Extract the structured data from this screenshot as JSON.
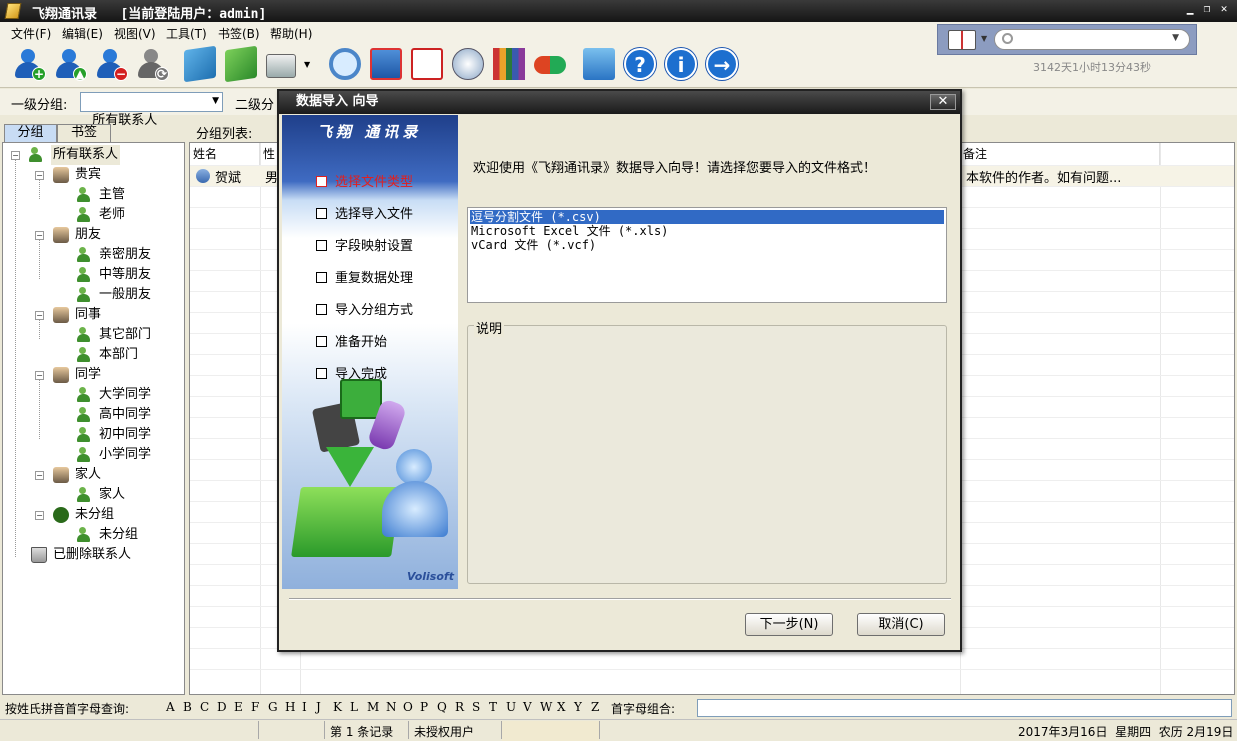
{
  "window": {
    "title": "飞翔通讯录   [当前登陆用户：admin]"
  },
  "menu": [
    "文件(F)",
    "编辑(E)",
    "视图(V)",
    "工具(T)",
    "书签(B)",
    "帮助(H)"
  ],
  "search": {
    "text": "3142天1小时13分43秒"
  },
  "toolbar": {
    "icons": [
      "add-contact-icon",
      "upload-contact-icon",
      "delete-contact-icon",
      "contact-settings-icon",
      "import-icon",
      "export-icon",
      "print-icon",
      "find-icon",
      "card-icon",
      "calendar-icon",
      "clock-icon",
      "books-icon",
      "hide-icon",
      "backup-icon",
      "help-icon",
      "info-icon",
      "next-icon"
    ]
  },
  "groupbar": {
    "level1_label": "一级分组:",
    "level1_value": "所有联系人",
    "level2_label": "二级分"
  },
  "tabs": [
    "分组",
    "书签"
  ],
  "list_label": "分组列表:",
  "tree": {
    "root": "所有联系人",
    "groups": [
      {
        "name": "贵宾",
        "children": [
          "主管",
          "老师"
        ]
      },
      {
        "name": "朋友",
        "children": [
          "亲密朋友",
          "中等朋友",
          "一般朋友"
        ]
      },
      {
        "name": "同事",
        "children": [
          "其它部门",
          "本部门"
        ]
      },
      {
        "name": "同学",
        "children": [
          "大学同学",
          "高中同学",
          "初中同学",
          "小学同学"
        ]
      },
      {
        "name": "家人",
        "children": [
          "家人"
        ]
      },
      {
        "name": "未分组",
        "children": [
          "未分组"
        ]
      }
    ],
    "deleted": "已删除联系人"
  },
  "grid": {
    "headers": {
      "name": "姓名",
      "gender": "性",
      "note": "备注"
    },
    "row": {
      "name": "贺斌",
      "gender": "男",
      "note": "本软件的作者。如有问题..."
    }
  },
  "dialog": {
    "title": "数据导入 向导",
    "logo": "飞翔 通讯录",
    "steps": [
      "选择文件类型",
      "选择导入文件",
      "字段映射设置",
      "重复数据处理",
      "导入分组方式",
      "准备开始",
      "导入完成"
    ],
    "current_step": 0,
    "welcome": "欢迎使用《飞翔通讯录》数据导入向导！请选择您要导入的文件格式！",
    "formats": [
      "逗号分割文件 (*.csv)",
      "Microsoft Excel 文件 (*.xls)",
      "vCard 文件 (*.vcf)"
    ],
    "selected_format": 0,
    "desc_label": "说明",
    "brand": "Volisoft",
    "next_button": "下一步(N)",
    "cancel_button": "取消(C)"
  },
  "alphabet": {
    "label": "按姓氏拼音首字母查询:",
    "letters": [
      "A",
      "B",
      "C",
      "D",
      "E",
      "F",
      "G",
      "H",
      "I",
      "J",
      "K",
      "L",
      "M",
      "N",
      "O",
      "P",
      "Q",
      "R",
      "S",
      "T",
      "U",
      "V",
      "W",
      "X",
      "Y",
      "Z"
    ],
    "combo_label": "首字母组合:"
  },
  "status": {
    "records": "第 1 条记录",
    "license": "未授权用户",
    "date": "2017年3月16日  星期四  农历 2月19日"
  }
}
